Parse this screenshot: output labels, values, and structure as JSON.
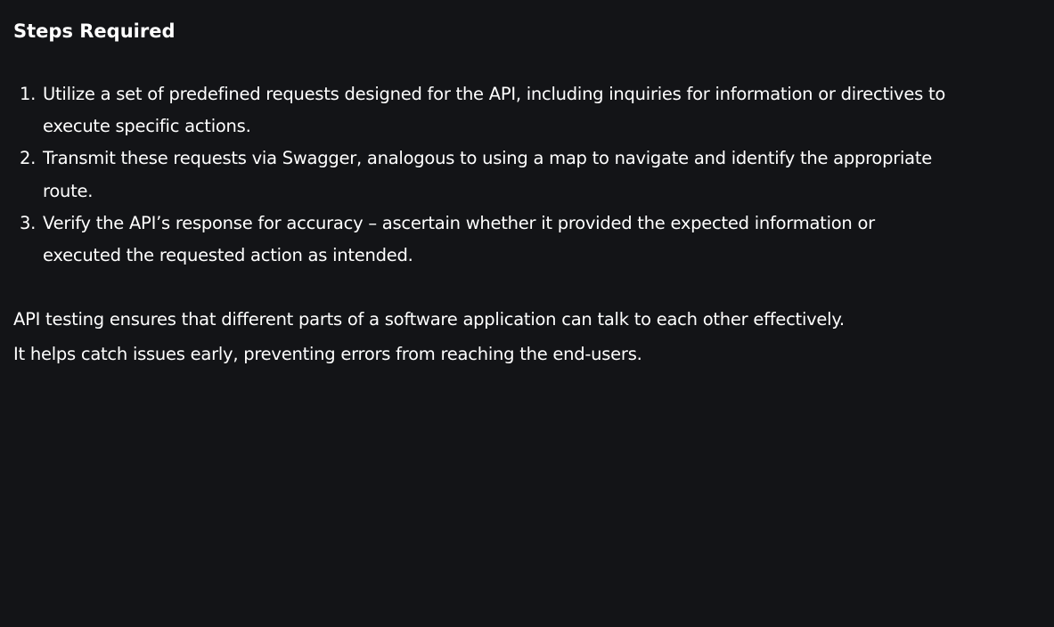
{
  "section": {
    "heading": "Steps Required",
    "steps": [
      {
        "number": "1.",
        "text": "Utilize a set of predefined requests designed for the API, including inquiries for information or directives to execute specific actions."
      },
      {
        "number": "2.",
        "text": "Transmit these requests via Swagger, analogous to using a map to navigate and identify the appropriate route."
      },
      {
        "number": "3.",
        "text": "Verify the API’s response for accuracy – ascertain whether it provided the expected information or executed the requested action as intended."
      }
    ],
    "summary_line_1": "API testing ensures that different parts of a software application can talk to each other effectively.",
    "summary_line_2": "It helps catch issues early, preventing errors from reaching the end-users."
  },
  "colors": {
    "background": "#131417",
    "text": "#ffffff"
  }
}
